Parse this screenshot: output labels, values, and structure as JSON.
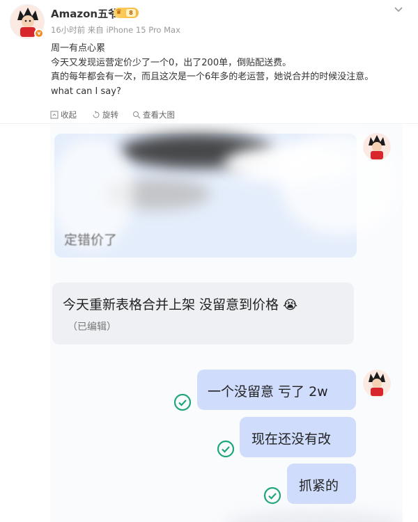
{
  "post": {
    "author": "Amazon五爷",
    "vip_level": "8",
    "meta": "16小时前 来自 iPhone 15 Pro Max",
    "lines": [
      "周一有点心累",
      "今天又发现运营定价少了一个0，出了200单，倒贴配送费。",
      "真的每年都会有一次，而且这次是一个6年多的老运营，她说合并的时候没注意。",
      "what can I say?"
    ]
  },
  "actions": {
    "collapse": "收起",
    "rotate": "旋转",
    "view_large": "查看大图"
  },
  "chat": {
    "blurred_msg": "定错价了",
    "msg_left": "今天重新表格合并上架 没留意到价格",
    "emoji": "😭",
    "edited": "（已编辑）",
    "msg_right_1": "一个没留意 亏了 2w",
    "msg_right_2": "现在还没有改",
    "msg_right_3": "抓紧的"
  },
  "colors": {
    "bubble_right": "#cfdcfc",
    "bubble_left": "#eef0f3",
    "check": "#1fa57a",
    "vip_badge": "#f6b73c"
  }
}
